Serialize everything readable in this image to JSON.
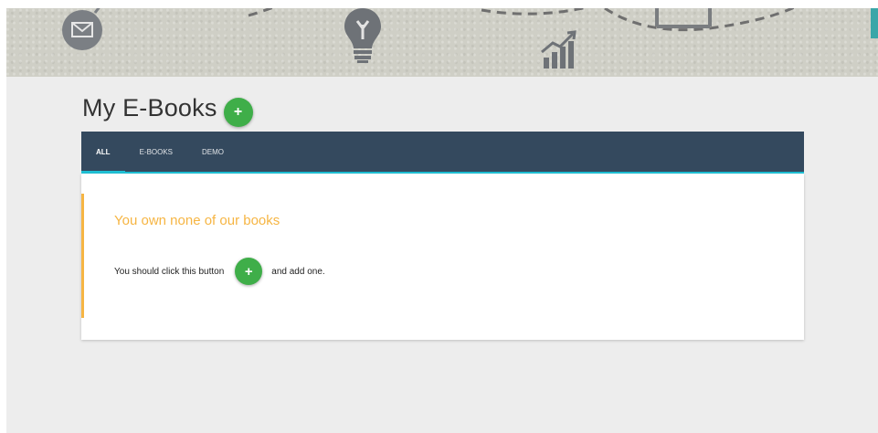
{
  "banner": {
    "icons": [
      "mail-icon",
      "lightbulb-icon",
      "chart-icon",
      "board-icon"
    ]
  },
  "page": {
    "title": "My E-Books",
    "add_button_label": "+"
  },
  "tabs": [
    {
      "label": "ALL",
      "active": true
    },
    {
      "label": "E-BOOKS",
      "active": false
    },
    {
      "label": "DEMO",
      "active": false
    }
  ],
  "notice": {
    "title": "You own none of our books",
    "text_before": "You should click this button",
    "button_label": "+",
    "text_after": "and add one."
  },
  "colors": {
    "tabs_bg": "#34495e",
    "tab_accent": "#1fc1d6",
    "add_button": "#3fae49",
    "notice_accent": "#f6b543"
  }
}
